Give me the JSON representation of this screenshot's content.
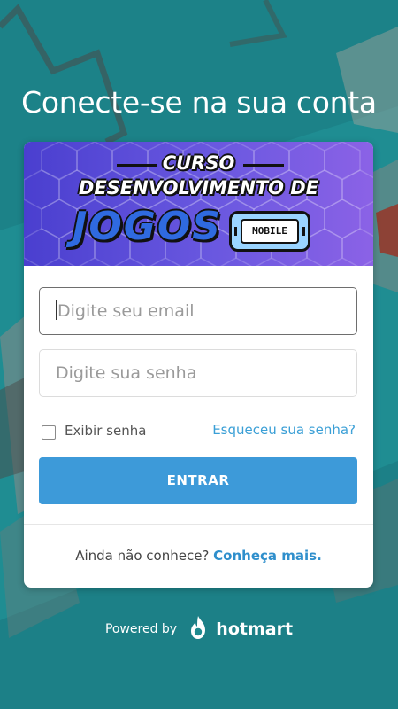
{
  "page": {
    "title": "Conecte-se na sua conta"
  },
  "banner": {
    "line1": "CURSO",
    "line2": "DESENVOLVIMENTO DE",
    "big": "JOGOS",
    "badge": "MOBILE"
  },
  "form": {
    "email_placeholder": "Digite seu email",
    "password_placeholder": "Digite sua senha",
    "show_password_label": "Exibir senha",
    "forgot_password_link": "Esqueceu sua senha?",
    "submit_label": "ENTRAR"
  },
  "footer_card": {
    "prompt": "Ainda não conhece?",
    "link": "Conheça mais."
  },
  "powered": {
    "by": "Powered by",
    "brand": "hotmart"
  },
  "colors": {
    "background": "#1f8a8f",
    "accent": "#3d9ad9",
    "link": "#3a9fd6"
  },
  "icons": {
    "checkbox": "checkbox-unchecked",
    "brand_logo": "hotmart-flame-icon"
  }
}
